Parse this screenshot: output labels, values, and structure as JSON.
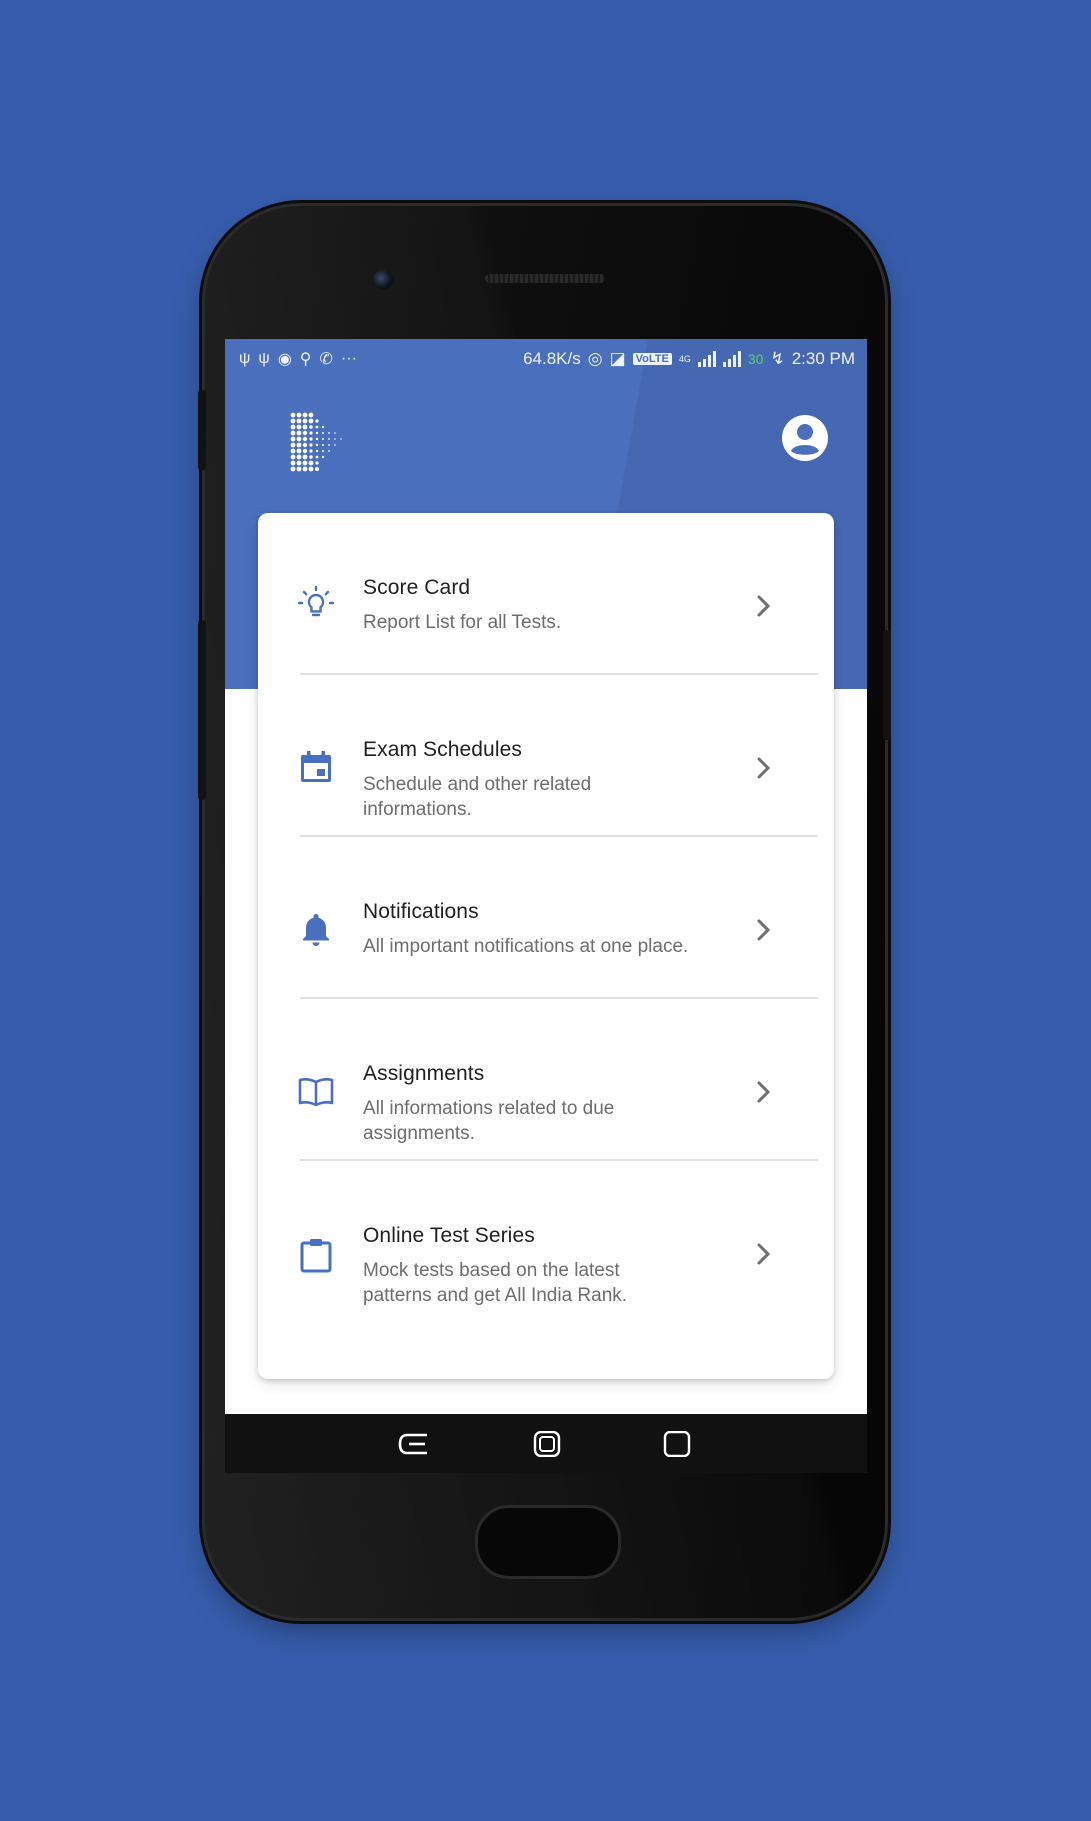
{
  "statusbar": {
    "left_icons": [
      "usb-icon",
      "usb-icon",
      "shield-icon",
      "trophy-icon",
      "whatsapp-icon",
      "more-icon"
    ],
    "speed": "64.8K/s",
    "volte": "VoLTE",
    "network": "4G",
    "battery": "30",
    "time": "2:30 PM"
  },
  "header": {
    "logo": "app-logo",
    "profile_icon": "account-circle-icon"
  },
  "menu": {
    "items": [
      {
        "icon": "lightbulb-icon",
        "title": "Score Card",
        "desc": "Report List for all Tests."
      },
      {
        "icon": "calendar-icon",
        "title": "Exam Schedules",
        "desc": "Schedule and other related informations."
      },
      {
        "icon": "bell-icon",
        "title": "Notifications",
        "desc": "All important notifications at one place."
      },
      {
        "icon": "book-icon",
        "title": "Assignments",
        "desc": "All informations related to due assignments."
      },
      {
        "icon": "clipboard-icon",
        "title": "Online Test Series",
        "desc": "Mock tests based on the latest patterns and get All India Rank."
      }
    ]
  },
  "navbar": {
    "back": "back-icon",
    "home": "home-icon",
    "recents": "recents-icon"
  },
  "colors": {
    "background": "#365dad",
    "header": "#4a6fbd",
    "accent_icon": "#4a6fbd",
    "card": "#ffffff"
  }
}
